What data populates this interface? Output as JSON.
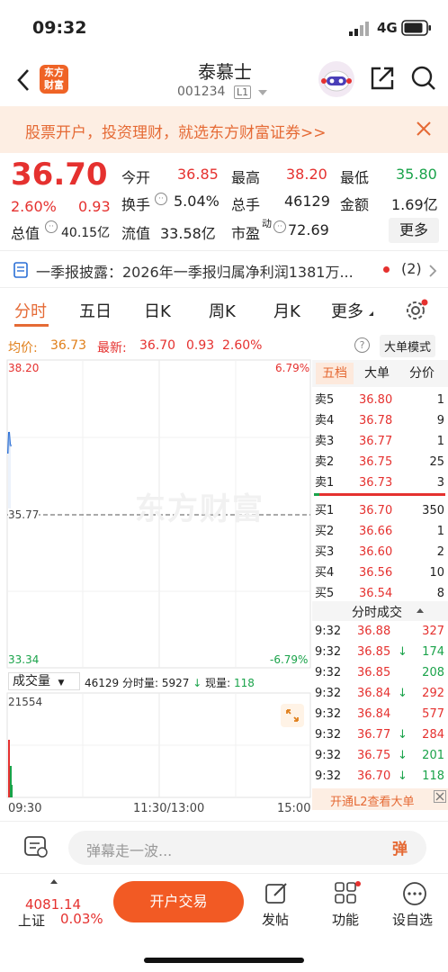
{
  "status": {
    "time": "09:32",
    "network": "4G"
  },
  "nav": {
    "title": "泰慕士",
    "code": "001234",
    "level": "L1",
    "logo_line1": "东方",
    "logo_line2": "财富"
  },
  "banner": {
    "text": "股票开户，投资理财，就选东方财富证券>>"
  },
  "quote": {
    "price": "36.70",
    "pct": "2.60%",
    "chg": "0.93",
    "open_label": "今开",
    "open": "36.85",
    "high_label": "最高",
    "high": "38.20",
    "low_label": "最低",
    "low": "35.80",
    "turnover_label": "换手",
    "turnover": "5.04%",
    "vol_label": "总手",
    "vol": "46129",
    "amount_label": "金额",
    "amount": "1.69亿",
    "mcap_label": "总值",
    "mcap": "40.15亿",
    "float_label": "流值",
    "float": "33.58亿",
    "pe_label": "市盈",
    "pe_sup": "动",
    "pe": "72.69",
    "more": "更多"
  },
  "news": {
    "text": "一季报披露：2026年一季报归属净利润1381万...",
    "count": "(2)"
  },
  "tabs": [
    "分时",
    "五日",
    "日K",
    "周K",
    "月K",
    "更多"
  ],
  "info": {
    "avg_label": "均价:",
    "avg": "36.73",
    "last_label": "最新:",
    "last": "36.70",
    "chg": "0.93",
    "pct": "2.60%",
    "mode": "大单模式"
  },
  "chart": {
    "price_high": "38.20",
    "pct_high": "6.79%",
    "price_mid": "35.77",
    "price_low": "33.34",
    "pct_low": "-6.79%",
    "watermark": "东方财富",
    "vol_label": "成交量",
    "vol_info_total": "46129",
    "vol_info_period_label": "分时量:",
    "vol_info_period": "5927",
    "vol_info_cur_label": "现量:",
    "vol_info_cur": "118",
    "vol_max": "21554",
    "time_start": "09:30",
    "time_mid": "11:30/13:00",
    "time_end": "15:00"
  },
  "panel": {
    "tabs": [
      "五档",
      "大单",
      "分价"
    ],
    "asks": [
      {
        "l": "卖5",
        "p": "36.80",
        "v": "1"
      },
      {
        "l": "卖4",
        "p": "36.78",
        "v": "9"
      },
      {
        "l": "卖3",
        "p": "36.77",
        "v": "1"
      },
      {
        "l": "卖2",
        "p": "36.75",
        "v": "25"
      },
      {
        "l": "卖1",
        "p": "36.73",
        "v": "3"
      }
    ],
    "bids": [
      {
        "l": "买1",
        "p": "36.70",
        "v": "350"
      },
      {
        "l": "买2",
        "p": "36.66",
        "v": "1"
      },
      {
        "l": "买3",
        "p": "36.60",
        "v": "2"
      },
      {
        "l": "买4",
        "p": "36.56",
        "v": "10"
      },
      {
        "l": "买5",
        "p": "36.54",
        "v": "8"
      }
    ],
    "trades_title": "分时成交",
    "trades": [
      {
        "t": "9:32",
        "p": "36.88",
        "d": "",
        "v": "327",
        "c": "red"
      },
      {
        "t": "9:32",
        "p": "36.85",
        "d": "↓",
        "v": "174",
        "c": "green"
      },
      {
        "t": "9:32",
        "p": "36.85",
        "d": "",
        "v": "208",
        "c": "green"
      },
      {
        "t": "9:32",
        "p": "36.84",
        "d": "↓",
        "v": "292",
        "c": "red"
      },
      {
        "t": "9:32",
        "p": "36.84",
        "d": "",
        "v": "577",
        "c": "red"
      },
      {
        "t": "9:32",
        "p": "36.77",
        "d": "↓",
        "v": "284",
        "c": "red"
      },
      {
        "t": "9:32",
        "p": "36.75",
        "d": "↓",
        "v": "201",
        "c": "green"
      },
      {
        "t": "9:32",
        "p": "36.70",
        "d": "↓",
        "v": "118",
        "c": "green"
      }
    ],
    "l2": "开通L2查看大单"
  },
  "bottom": {
    "danmaku_placeholder": "弹幕走一波...",
    "danmaku_btn": "弹",
    "index_value": "4081.14",
    "index_name": "上证",
    "index_pct": "0.03%",
    "trade_btn": "开户交易",
    "post": "发帖",
    "func": "功能",
    "settings": "设自选"
  }
}
